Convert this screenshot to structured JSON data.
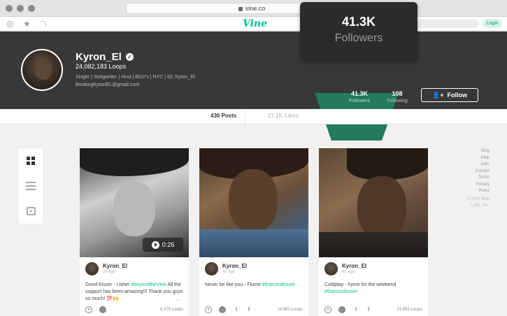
{
  "browser": {
    "url": "vine.co"
  },
  "nav": {
    "logo": "Vine",
    "login_label": "Login"
  },
  "profile": {
    "username": "Kyron_El",
    "loops": "24,082,183 Loops",
    "bio": "Singer | Songwriter | Host | BGV's | NYC | IG: Kyron_El",
    "email": "BookingKyronEL@gmail.com",
    "followers_count": "41.3K",
    "followers_label": "Followers",
    "following_count": "108",
    "following_label": "Following",
    "follow_label": "Follow"
  },
  "tooltip": {
    "count": "41.3K",
    "label": "Followers"
  },
  "tabs": {
    "posts": "430 Posts",
    "likes": "27.1K Likes"
  },
  "posts": [
    {
      "username": "Kyron_El",
      "time": "20 ago",
      "caption_pre": "Good Kisser - Usher ",
      "caption_tag": "#beyondtheVine",
      "caption_post": " All the support has been amazing!!! Thank you guys so much! 💯🙌",
      "duration": "0:26",
      "loops": "6,475 Loops",
      "more": "..."
    },
    {
      "username": "Kyron_El",
      "time": "42 ago",
      "caption_pre": "Never be like you - Flume ",
      "caption_tag": "#6secondcover",
      "caption_post": "",
      "loops": "16,981 Loops"
    },
    {
      "username": "Kyron_El",
      "time": "65 ago",
      "caption_pre": "Coldplay - hymn for the weekend ",
      "caption_tag": "#6secondcover",
      "caption_post": "",
      "loops": "21,652 Loops"
    }
  ],
  "side_links": [
    "Blog",
    "Help",
    "Jobs",
    "Contact",
    "Terms",
    "Privacy",
    "Rules"
  ],
  "copyright": [
    "© 2016 Vine",
    "Labs, Inc."
  ],
  "colors": {
    "accent": "#00bf8f",
    "header_bg": "#383838",
    "highlight": "#237a5e"
  }
}
